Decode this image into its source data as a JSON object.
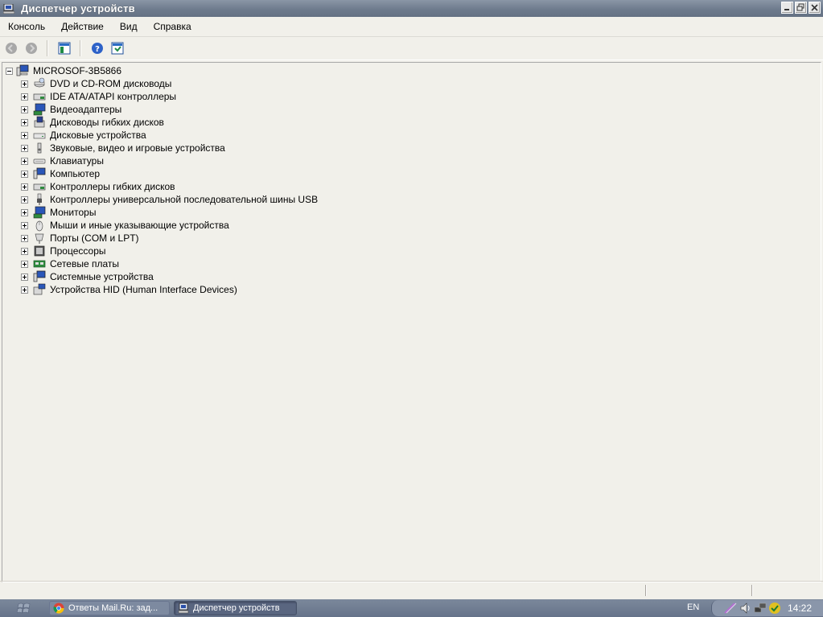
{
  "window": {
    "title": "Диспетчер устройств"
  },
  "menubar": {
    "items": [
      "Консоль",
      "Действие",
      "Вид",
      "Справка"
    ]
  },
  "toolbar": {
    "buttons": [
      "back-icon",
      "forward-icon",
      "show-hide-tree-icon",
      "help-icon",
      "properties-icon"
    ]
  },
  "tree": {
    "root": {
      "label": "MICROSOF-3B5866",
      "icon": "computer-icon",
      "expanded": true
    },
    "categories": [
      {
        "label": "DVD и CD-ROM дисководы",
        "icon": "cdrom-icon"
      },
      {
        "label": "IDE ATA/ATAPI контроллеры",
        "icon": "ide-controller-icon"
      },
      {
        "label": "Видеоадаптеры",
        "icon": "display-adapter-icon"
      },
      {
        "label": "Дисководы гибких дисков",
        "icon": "floppy-drive-icon"
      },
      {
        "label": "Дисковые устройства",
        "icon": "disk-drive-icon"
      },
      {
        "label": "Звуковые, видео и игровые устройства",
        "icon": "sound-icon"
      },
      {
        "label": "Клавиатуры",
        "icon": "keyboard-icon"
      },
      {
        "label": "Компьютер",
        "icon": "computer-icon"
      },
      {
        "label": "Контроллеры гибких дисков",
        "icon": "floppy-controller-icon"
      },
      {
        "label": "Контроллеры универсальной последовательной шины USB",
        "icon": "usb-icon"
      },
      {
        "label": "Мониторы",
        "icon": "monitor-icon"
      },
      {
        "label": "Мыши и иные указывающие устройства",
        "icon": "mouse-icon"
      },
      {
        "label": "Порты (COM и LPT)",
        "icon": "port-icon"
      },
      {
        "label": "Процессоры",
        "icon": "processor-icon"
      },
      {
        "label": "Сетевые платы",
        "icon": "network-adapter-icon"
      },
      {
        "label": "Системные устройства",
        "icon": "system-devices-icon"
      },
      {
        "label": "Устройства HID (Human Interface Devices)",
        "icon": "hid-icon"
      }
    ]
  },
  "taskbar": {
    "tasks": [
      {
        "label": "Ответы Mail.Ru: зад...",
        "icon": "chrome-icon",
        "active": false
      },
      {
        "label": "Диспетчер устройств",
        "icon": "device-manager-icon",
        "active": true
      }
    ],
    "language": "EN",
    "clock": "14:22",
    "tray_icons": [
      "pen-icon",
      "volume-icon",
      "network-icon",
      "security-icon"
    ]
  }
}
